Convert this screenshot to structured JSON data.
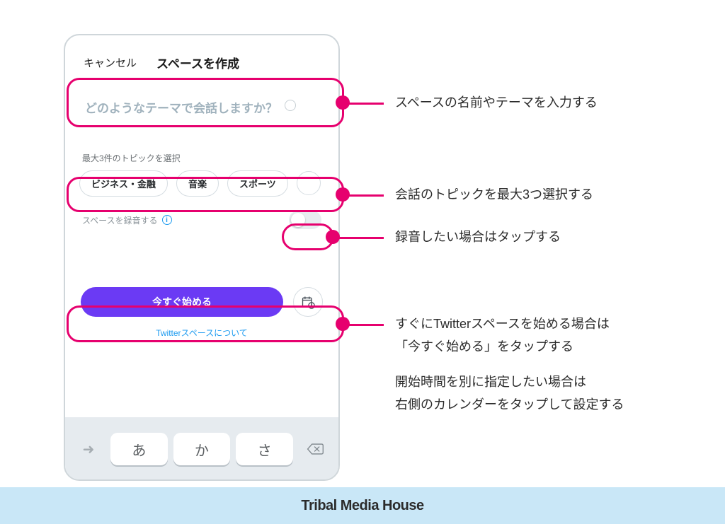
{
  "header": {
    "cancel": "キャンセル",
    "title": "スペースを作成"
  },
  "theme_input": {
    "placeholder": "どのようなテーマで会話しますか？"
  },
  "topics": {
    "label": "最大3件のトピックを選択",
    "chips": [
      "ビジネス・金融",
      "音楽",
      "スポーツ"
    ]
  },
  "record": {
    "label": "スペースを録音する"
  },
  "start": {
    "button": "今すぐ始める",
    "about_link": "Twitterスペースについて"
  },
  "keyboard": {
    "keys": [
      "あ",
      "か",
      "さ"
    ]
  },
  "callouts": {
    "c1": "スペースの名前やテーマを入力する",
    "c2": "会話のトピックを最大3つ選択する",
    "c3": "録音したい場合はタップする",
    "c4a": "すぐにTwitterスペースを始める場合は",
    "c4b": "「今すぐ始める」をタップする",
    "c5a": "開始時間を別に指定したい場合は",
    "c5b": "右側のカレンダーをタップして設定する"
  },
  "footer": "Tribal Media House"
}
